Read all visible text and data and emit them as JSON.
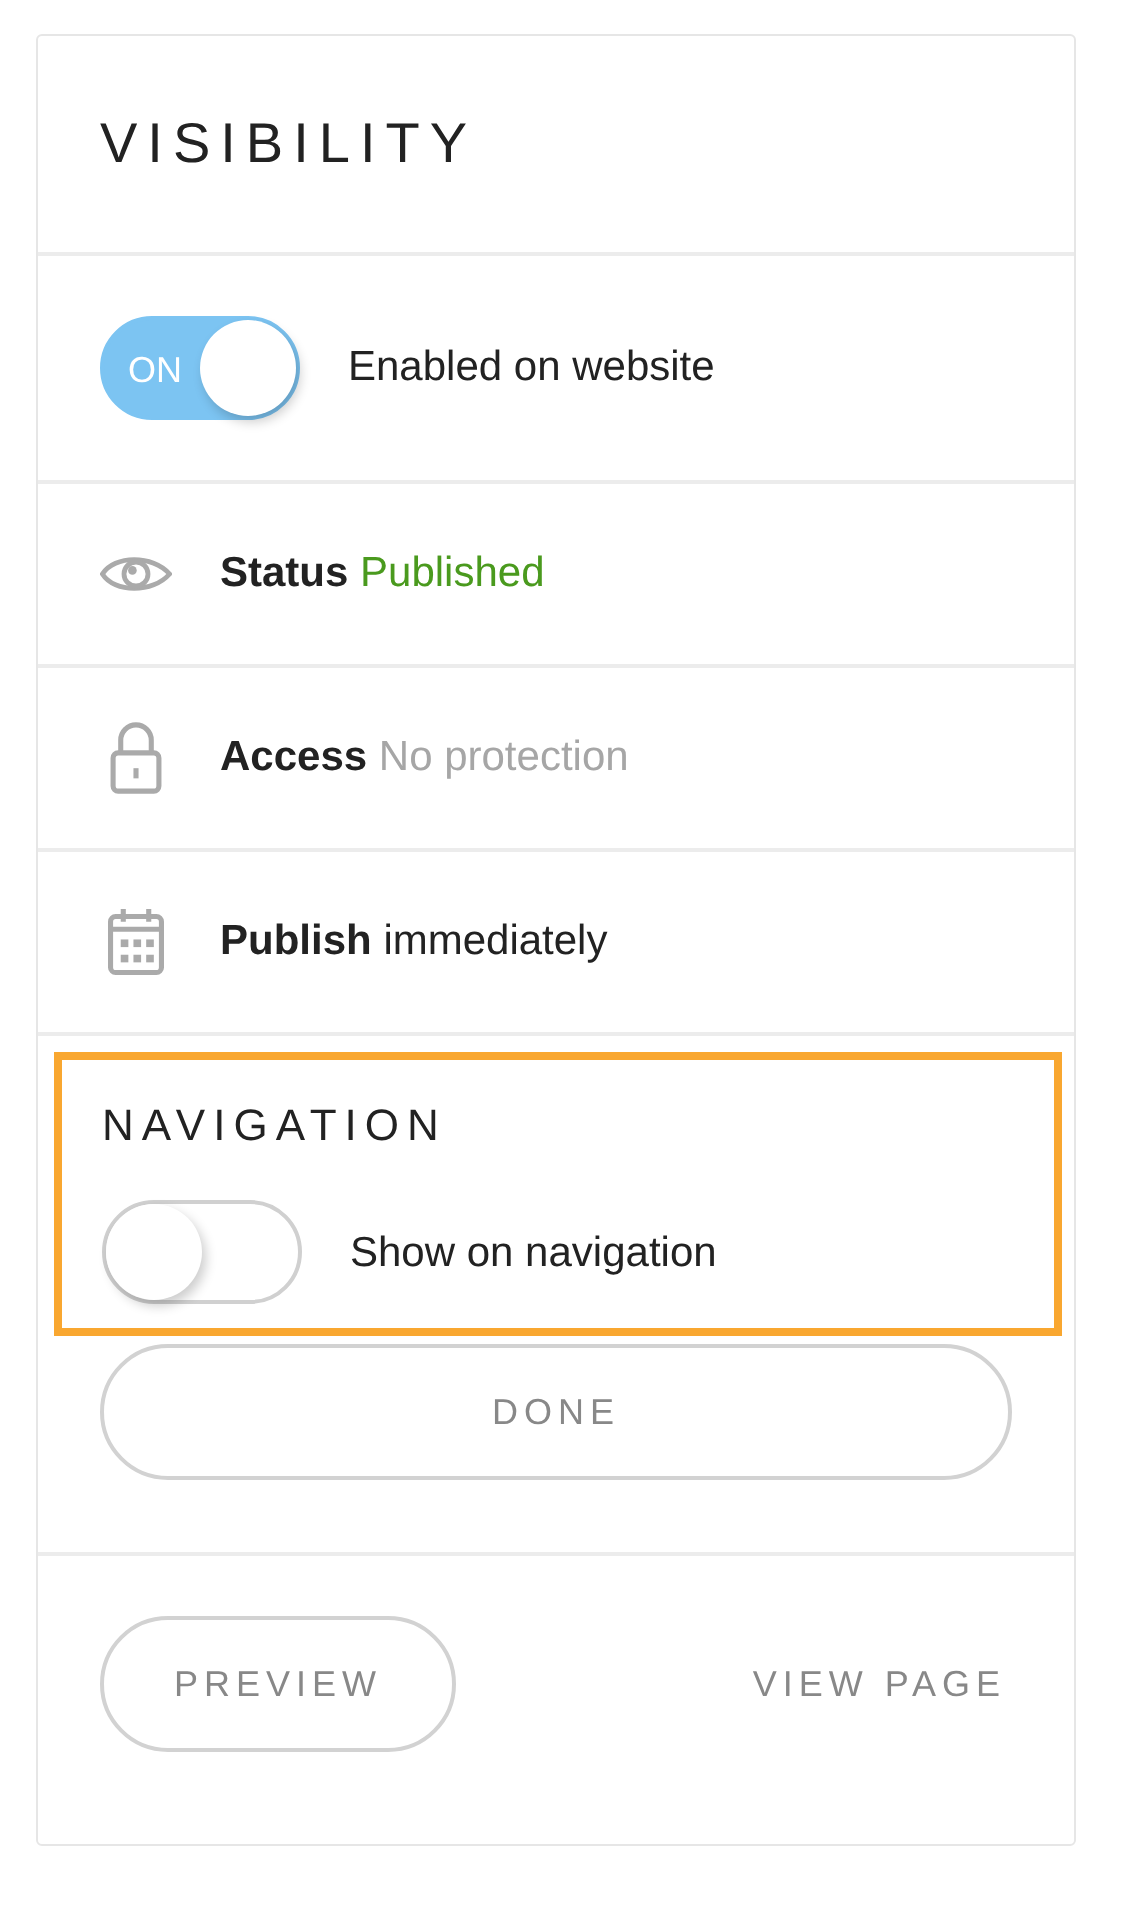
{
  "title": "VISIBILITY",
  "enabled_toggle": {
    "on": true,
    "state_label": "ON",
    "label": "Enabled on website"
  },
  "rows": [
    {
      "kind": "eye",
      "label": "Status",
      "value": "Published",
      "color": "#4a9a1e"
    },
    {
      "kind": "lock",
      "label": "Access",
      "value": "No protection",
      "color": "#a6a6a6"
    },
    {
      "kind": "calendar",
      "label": "Publish",
      "value": "immediately",
      "color": "#222222"
    }
  ],
  "navigation": {
    "highlighted": true,
    "title": "NAVIGATION",
    "toggle": {
      "on": false,
      "label": "Show on navigation"
    }
  },
  "done_button": "DONE",
  "footer": {
    "preview_button": "PREVIEW",
    "view_link": "VIEW PAGE"
  }
}
